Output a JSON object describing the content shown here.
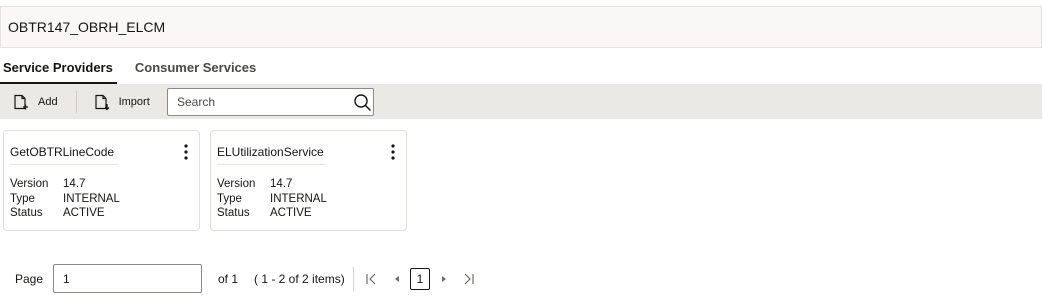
{
  "header": {
    "title": "OBTR147_OBRH_ELCM"
  },
  "tabs": [
    {
      "label": "Service Providers"
    },
    {
      "label": "Consumer Services"
    }
  ],
  "toolbar": {
    "add_label": "Add",
    "import_label": "Import",
    "search_placeholder": "Search"
  },
  "cards": [
    {
      "title": "GetOBTRLineCode",
      "props": [
        {
          "key": "Version",
          "value": "14.7"
        },
        {
          "key": "Type",
          "value": "INTERNAL"
        },
        {
          "key": "Status",
          "value": "ACTIVE"
        }
      ]
    },
    {
      "title": "ELUtilizationService",
      "props": [
        {
          "key": "Version",
          "value": "14.7"
        },
        {
          "key": "Type",
          "value": "INTERNAL"
        },
        {
          "key": "Status",
          "value": "ACTIVE"
        }
      ]
    }
  ],
  "pagination": {
    "page_label": "Page",
    "page_value": "1",
    "of_label": "of 1",
    "range_text": "( 1 - 2 of 2 items)",
    "current_page": "1"
  }
}
